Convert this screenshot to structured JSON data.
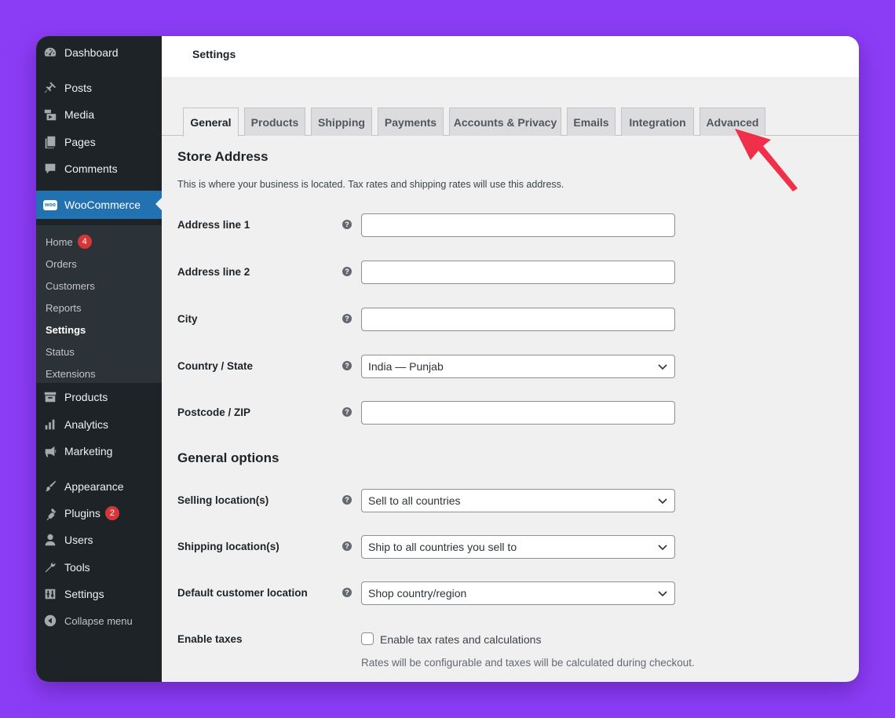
{
  "sidebar": {
    "top_items": [
      "Dashboard",
      "Posts",
      "Media",
      "Pages",
      "Comments"
    ],
    "woocommerce_label": "WooCommerce",
    "woo_badge": "woo",
    "submenu": [
      {
        "label": "Home",
        "badge": "4"
      },
      {
        "label": "Orders"
      },
      {
        "label": "Customers"
      },
      {
        "label": "Reports"
      },
      {
        "label": "Settings"
      },
      {
        "label": "Status"
      },
      {
        "label": "Extensions"
      }
    ],
    "mid_items": [
      "Products",
      "Analytics",
      "Marketing"
    ],
    "bottom_items": [
      {
        "label": "Appearance"
      },
      {
        "label": "Plugins",
        "badge": "2"
      },
      {
        "label": "Users"
      },
      {
        "label": "Tools"
      },
      {
        "label": "Settings"
      }
    ],
    "collapse_label": "Collapse menu"
  },
  "topbar": {
    "title": "Settings"
  },
  "tabs": [
    "General",
    "Products",
    "Shipping",
    "Payments",
    "Accounts & Privacy",
    "Emails",
    "Integration",
    "Advanced"
  ],
  "store_address": {
    "heading": "Store Address",
    "description": "This is where your business is located. Tax rates and shipping rates will use this address.",
    "fields": [
      {
        "label": "Address line 1",
        "value": ""
      },
      {
        "label": "Address line 2",
        "value": ""
      },
      {
        "label": "City",
        "value": ""
      },
      {
        "label": "Country / State",
        "value": "India — Punjab"
      },
      {
        "label": "Postcode / ZIP",
        "value": ""
      }
    ]
  },
  "general_options": {
    "heading": "General options",
    "fields": [
      {
        "label": "Selling location(s)",
        "value": "Sell to all countries"
      },
      {
        "label": "Shipping location(s)",
        "value": "Ship to all countries you sell to"
      },
      {
        "label": "Default customer location",
        "value": "Shop country/region"
      }
    ],
    "taxes": {
      "label": "Enable taxes",
      "checkbox_label": "Enable tax rates and calculations",
      "checked": false,
      "note": "Rates will be configurable and taxes will be calculated during checkout."
    }
  },
  "help_glyph": "?",
  "colors": {
    "accent": "#2271b1",
    "sidebar": "#1d2327",
    "background": "#8b3df5",
    "arrow": "#f0304a"
  }
}
